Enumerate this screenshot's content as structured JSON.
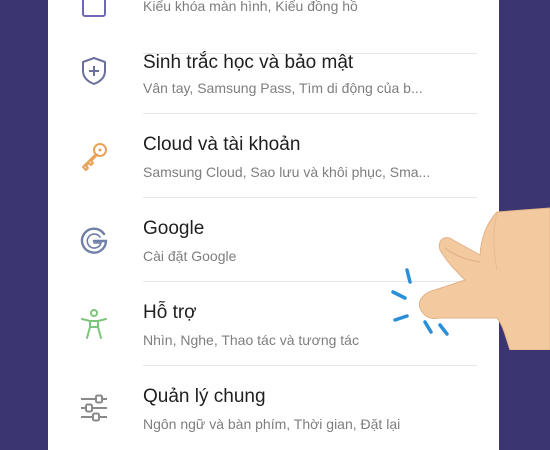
{
  "settings": {
    "items": [
      {
        "title": "",
        "subtitle": "Kiểu khóa màn hình, Kiểu đồng hồ",
        "icon": "lock-screen-icon",
        "color": "#6f67b8"
      },
      {
        "title": "Sinh trắc học và bảo mật",
        "subtitle": "Vân tay, Samsung Pass, Tìm di động của b...",
        "icon": "shield-plus-icon",
        "color": "#6b6f9c"
      },
      {
        "title": "Cloud và tài khoản",
        "subtitle": "Samsung Cloud, Sao lưu và khôi phục, Sma...",
        "icon": "key-icon",
        "color": "#e8a25a"
      },
      {
        "title": "Google",
        "subtitle": "Cài đặt Google",
        "icon": "google-g-icon",
        "color": "#6f7fa8"
      },
      {
        "title": "Hỗ trợ",
        "subtitle": "Nhìn, Nghe, Thao tác và tương tác",
        "icon": "accessibility-person-icon",
        "color": "#7cc57a"
      },
      {
        "title": "Quản lý chung",
        "subtitle": "Ngôn ngữ và bàn phím, Thời gian, Đặt lại",
        "icon": "sliders-icon",
        "color": "#8a8a8a"
      }
    ]
  },
  "colors": {
    "background": "#3b3572",
    "card": "#ffffff",
    "title": "#1f1f1f",
    "subtitle": "#7e7e7e",
    "tap_lines": "#2a8fd6",
    "hand": "#f3c9a0"
  }
}
